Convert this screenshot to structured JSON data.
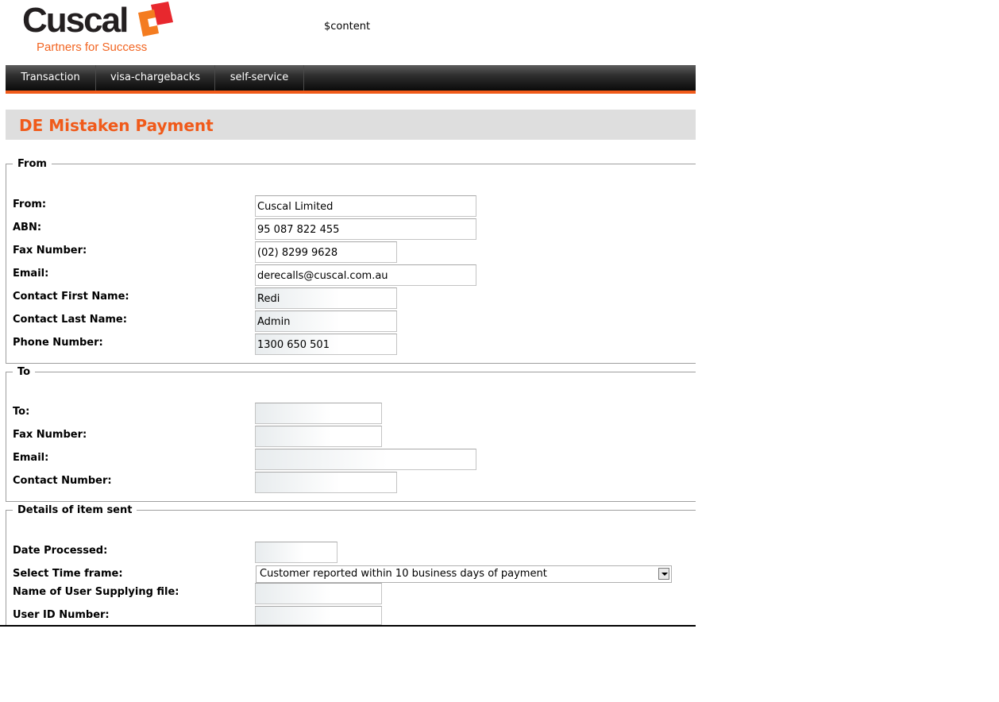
{
  "logo": {
    "word": "Cuscal",
    "tagline": "Partners for Success"
  },
  "placeholder_text": "$content",
  "nav": {
    "items": [
      {
        "label": "Transaction"
      },
      {
        "label": "visa-chargebacks"
      },
      {
        "label": "self-service"
      }
    ]
  },
  "page_title": "DE Mistaken Payment",
  "from_section": {
    "legend": "From",
    "from_label": "From:",
    "from_value": "Cuscal Limited",
    "abn_label": "ABN:",
    "abn_value": "95 087 822 455",
    "fax_label": "Fax Number:",
    "fax_value": "(02) 8299 9628",
    "email_label": "Email:",
    "email_value": "derecalls@cuscal.com.au",
    "first_name_label": "Contact First Name:",
    "first_name_value": "Redi",
    "last_name_label": "Contact Last Name:",
    "last_name_value": "Admin",
    "phone_label": "Phone Number:",
    "phone_value": "1300 650 501"
  },
  "to_section": {
    "legend": "To",
    "to_label": "To:",
    "to_value": "",
    "fax_label": "Fax Number:",
    "fax_value": "",
    "email_label": "Email:",
    "email_value": "",
    "contact_label": "Contact Number:",
    "contact_value": ""
  },
  "details_section": {
    "legend": "Details of item sent",
    "date_label": "Date Processed:",
    "date_value": "",
    "timeframe_label": "Select Time frame:",
    "timeframe_selected": "Customer reported within 10 business days of payment",
    "user_name_label": "Name of User Supplying file:",
    "user_name_value": "",
    "user_id_label": "User ID Number:",
    "user_id_value": ""
  },
  "colors": {
    "accent": "#f05a1a",
    "title_bar_bg": "#dedede",
    "nav_bg": "#1a1a1a"
  }
}
